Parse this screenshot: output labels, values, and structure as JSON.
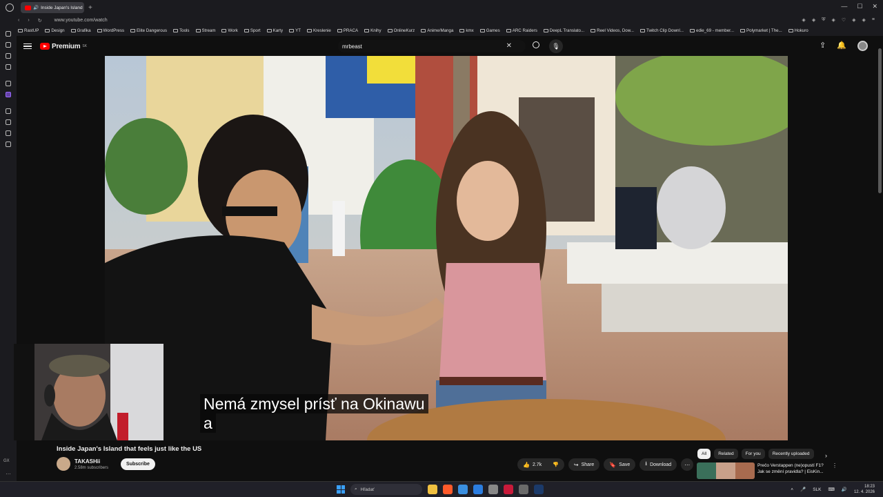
{
  "browser": {
    "tab_title": "Inside Japan's Island",
    "url": "www.youtube.com/watch",
    "bookmarks": [
      "RastUP",
      "Design",
      "Grafika",
      "WordPress",
      "Elite Dangerous",
      "Tools",
      "Stream",
      "Work",
      "Sport",
      "Karty",
      "YT",
      "Kreslenie",
      "PRACA",
      "Knihy",
      "OnlineKurz",
      "Anime/Manga",
      "kmx",
      "Games",
      "ARC Raiders",
      "DeepL Translato...",
      "Reel Videos, Dow...",
      "Twitch Clip Downl...",
      "edie_69 - member...",
      "Polymarket | The...",
      "Hokuro"
    ],
    "sidebar_label": "GX"
  },
  "youtube": {
    "logo_text": "Premium",
    "logo_country": "SK",
    "search_value": "mrbeast",
    "subtitle_line1": "Nemá zmysel prísť na Okinawu",
    "subtitle_line2": "a",
    "video_title": "Inside Japan's Island that feels just like the US",
    "channel_name": "TAKASHii",
    "channel_subs": "2.58m subscribers",
    "subscribe_label": "Subscribe",
    "like_count": "2.7k",
    "share_label": "Share",
    "save_label": "Save",
    "download_label": "Download",
    "chips": [
      "All",
      "Related",
      "For you",
      "Recently uploaded"
    ],
    "rec_title_line1": "Prečo Verstappen (ne)opustí F1?",
    "rec_title_line2": "Jak se změní pravidla? | EisKin..."
  },
  "taskbar": {
    "search_placeholder": "Hľadať",
    "lang": "SLK",
    "time": "18:23",
    "date": "12. 4. 2026"
  }
}
